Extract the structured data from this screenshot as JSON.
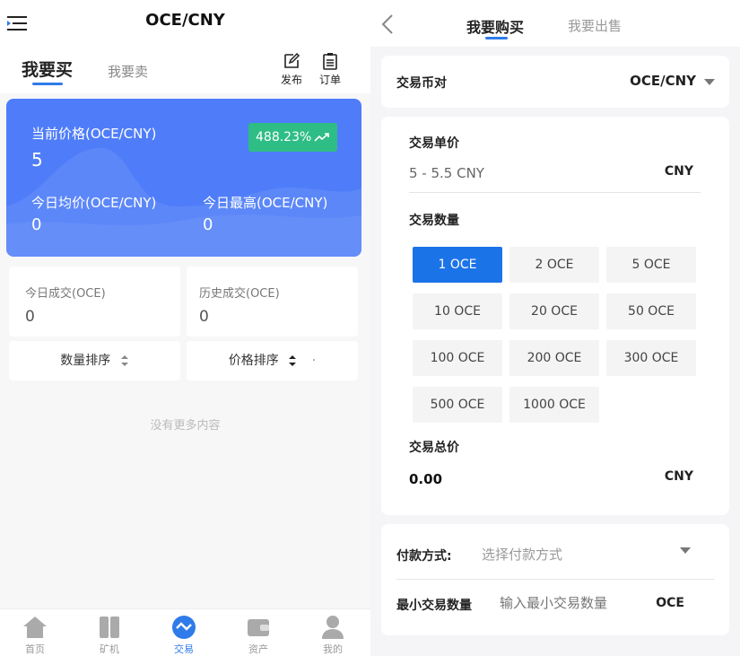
{
  "left": {
    "title": "OCE/CNY",
    "tabs": {
      "buy": "我要买",
      "sell": "我要卖"
    },
    "actions": {
      "publish": "发布",
      "orders": "订单"
    },
    "hero": {
      "current_price_label": "当前价格(OCE/CNY)",
      "current_price_value": "5",
      "change_badge": "488.23%",
      "avg_price_label": "今日均价(OCE/CNY)",
      "avg_price_value": "0",
      "high_price_label": "今日最高(OCE/CNY)",
      "high_price_value": "0"
    },
    "stats": [
      {
        "label": "今日成交(OCE)",
        "value": "0"
      },
      {
        "label": "历史成交(OCE)",
        "value": "0"
      }
    ],
    "sort": {
      "quantity": "数量排序",
      "price": "价格排序"
    },
    "empty_text": "没有更多内容",
    "bottom_nav": [
      {
        "label": "首页",
        "icon": "home-icon",
        "active": false
      },
      {
        "label": "矿机",
        "icon": "miner-icon",
        "active": false
      },
      {
        "label": "交易",
        "icon": "trade-icon",
        "active": true
      },
      {
        "label": "资产",
        "icon": "wallet-icon",
        "active": false
      },
      {
        "label": "我的",
        "icon": "user-icon",
        "active": false
      }
    ]
  },
  "right": {
    "tabs": {
      "buy": "我要购买",
      "sell": "我要出售"
    },
    "pair_label": "交易币对",
    "pair_value": "OCE/CNY",
    "unit_price_label": "交易单价",
    "unit_price_value": "5 - 5.5 CNY",
    "unit_price_unit": "CNY",
    "quantity_label": "交易数量",
    "quantities": [
      "1 OCE",
      "2 OCE",
      "5 OCE",
      "10 OCE",
      "20 OCE",
      "50 OCE",
      "100 OCE",
      "200 OCE",
      "300 OCE",
      "500 OCE",
      "1000 OCE"
    ],
    "selected_quantity": "1 OCE",
    "total_label": "交易总价",
    "total_value": "0.00",
    "total_unit": "CNY",
    "payment_label": "付款方式:",
    "payment_placeholder": "选择付款方式",
    "min_qty_label": "最小交易数量",
    "min_qty_placeholder": "输入最小交易数量",
    "min_qty_unit": "OCE"
  },
  "colors": {
    "accent": "#2f7be9",
    "hero_bg": "#4f7df9",
    "badge": "#2ebd85",
    "selected_qty": "#1b73e8"
  }
}
